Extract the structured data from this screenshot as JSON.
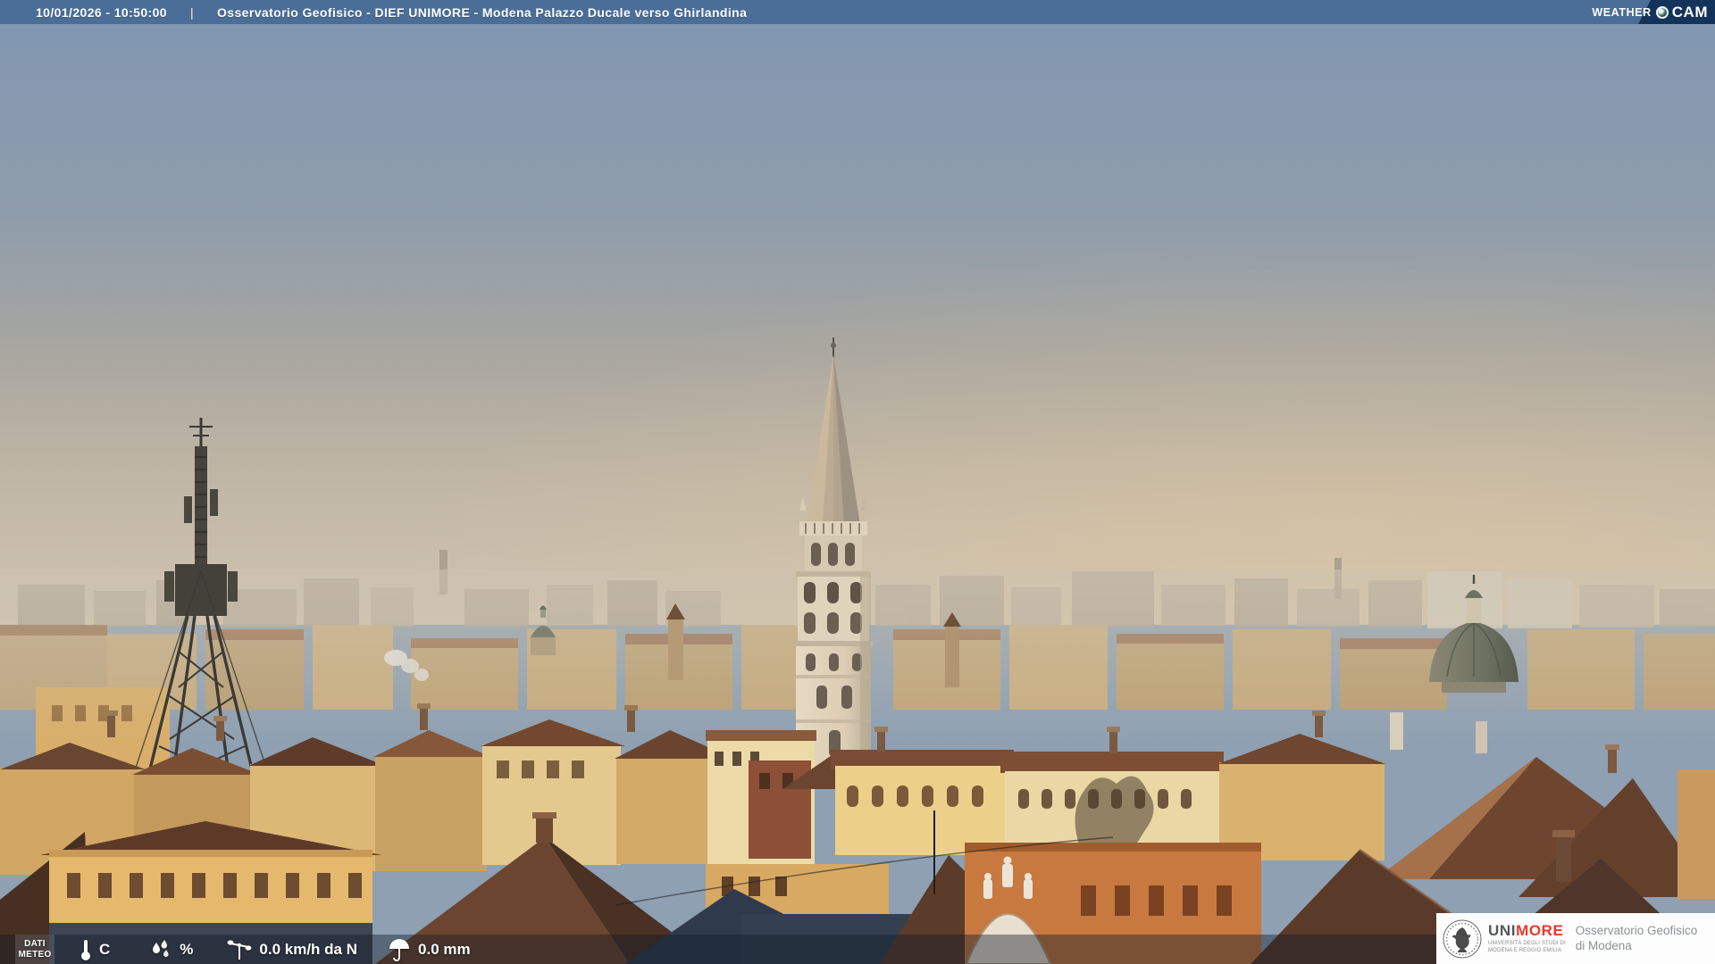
{
  "header": {
    "timestamp": "10/01/2026 - 10:50:00",
    "separator": "|",
    "title": "Osservatorio Geofisico - DIEF UNIMORE - Modena Palazzo Ducale verso Ghirlandina"
  },
  "weathercam": {
    "brand_left": "Weather",
    "brand_right": "CAM"
  },
  "meteo_bar": {
    "label_line1": "DATI",
    "label_line2": "METEO",
    "temperature": {
      "icon": "thermometer-icon",
      "value": "",
      "unit": "C"
    },
    "humidity": {
      "icon": "humidity-drops-icon",
      "value": "",
      "unit": "%"
    },
    "wind": {
      "icon": "anemometer-icon",
      "value": "0.0 km/h da N"
    },
    "rain": {
      "icon": "umbrella-icon",
      "value": "0.0 mm"
    }
  },
  "logo_box": {
    "brand_uni": "UNI",
    "brand_more": "MORE",
    "brand_sub_line1": "UNIVERSITÀ DEGLI STUDI DI",
    "brand_sub_line2": "MODENA E REGGIO EMILIA",
    "org_line1": "Osservatorio Geofisico",
    "org_line2": "di Modena"
  },
  "colors": {
    "header_bar": "#4a6e98",
    "weathercam_panel": "#14335a",
    "unimore_red": "#e63b2e",
    "unimore_gray": "#57585a",
    "meteo_overlay": "rgba(16,26,40,0.42)"
  },
  "scene": {
    "landmarks": [
      "ghirlandina-tower",
      "telecom-lattice-tower",
      "church-dome",
      "small-dome",
      "city-rooftops",
      "hazy-skyline",
      "smoke-plume"
    ]
  }
}
